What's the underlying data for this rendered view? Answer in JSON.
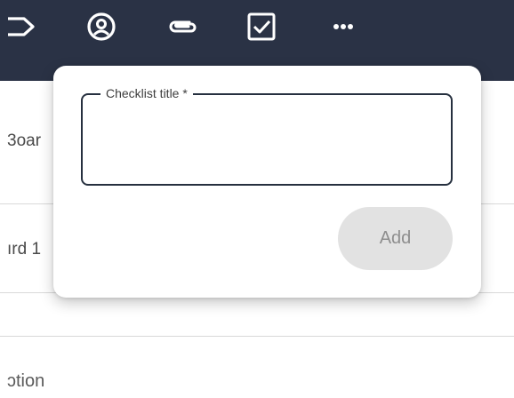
{
  "toolbar": {
    "icons": [
      "label-icon",
      "user-circle-icon",
      "paperclip-icon",
      "checkbox-checked-icon",
      "more-horizontal-icon"
    ]
  },
  "background": {
    "row1_text": "3oar",
    "row2_text": "ırd 1",
    "description_text": "ɔtion"
  },
  "checklist_popover": {
    "title_label": "Checklist title *",
    "title_value": "",
    "add_label": "Add"
  },
  "colors": {
    "toolbar_bg": "#2a3245",
    "field_border": "#26303f",
    "button_disabled_bg": "#e2e2e2",
    "button_disabled_text": "#8e8e8e"
  }
}
